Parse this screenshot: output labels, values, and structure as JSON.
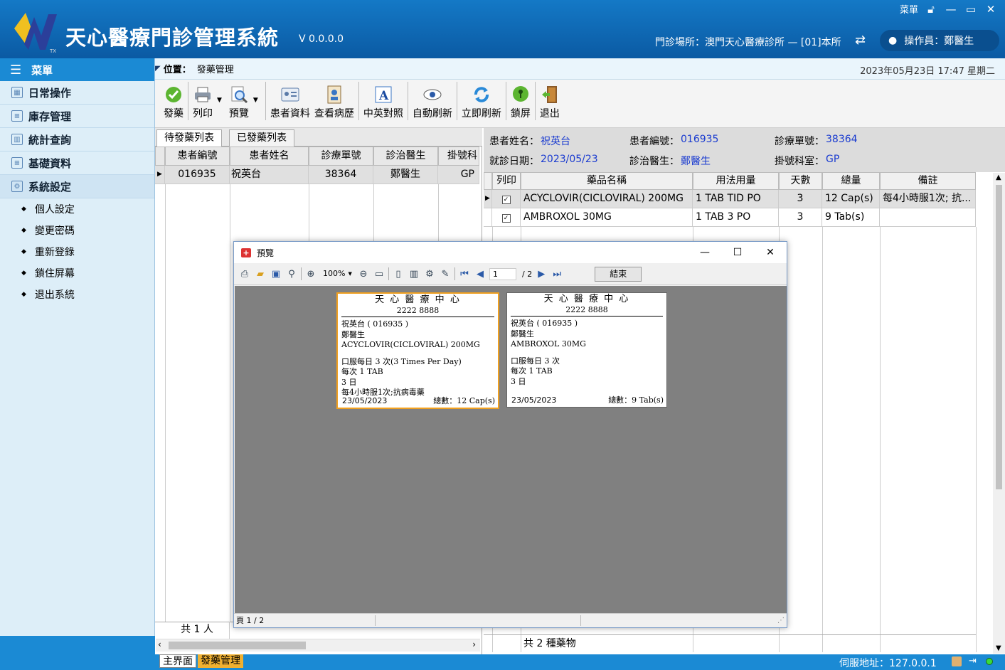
{
  "app": {
    "title": "天心醫療門診管理系統",
    "version": "V 0.0.0.0"
  },
  "header": {
    "menu_label": "菜單",
    "clinic_label": "門診場所：澳門天心醫療診所 — [01]本所",
    "operator_label": "操作員：鄭醫生"
  },
  "sidebar": {
    "title": "菜單",
    "items": [
      {
        "label": "日常操作"
      },
      {
        "label": "庫存管理"
      },
      {
        "label": "統計查詢"
      },
      {
        "label": "基礎資料"
      },
      {
        "label": "系統設定"
      }
    ],
    "sub_items": [
      {
        "label": "個人設定"
      },
      {
        "label": "變更密碼"
      },
      {
        "label": "重新登錄"
      },
      {
        "label": "鎖住屏幕"
      },
      {
        "label": "退出系統"
      }
    ]
  },
  "location": {
    "label": "位置：",
    "value": "發藥管理",
    "datetime": "2023年05月23日 17:47  星期二"
  },
  "toolbar": {
    "dispense": "發藥",
    "print": "列印",
    "preview": "預覽",
    "patient_info": "患者資料",
    "view_history": "查看病歷",
    "cn_en": "中英對照",
    "auto_refresh": "自動刷新",
    "refresh_now": "立即刷新",
    "lock_screen": "鎖屏",
    "exit": "退出"
  },
  "tabs": {
    "pending": "待發藥列表",
    "dispensed": "已發藥列表"
  },
  "left_grid": {
    "headers": [
      "患者編號",
      "患者姓名",
      "診療單號",
      "診治醫生",
      "掛號科"
    ],
    "rows": [
      [
        "016935",
        "祝英台",
        "38364",
        "鄭醫生",
        "GP"
      ]
    ],
    "footer": "共 1 人"
  },
  "patient_info": {
    "name_label": "患者姓名：",
    "name": "祝英台",
    "id_label": "患者編號：",
    "id": "016935",
    "order_label": "診療單號：",
    "order": "38364",
    "date_label": "就診日期：",
    "date": "2023/05/23",
    "doctor_label": "診治醫生：",
    "doctor": "鄭醫生",
    "dept_label": "掛號科室：",
    "dept": "GP"
  },
  "right_grid": {
    "headers": [
      "列印",
      "藥品名稱",
      "用法用量",
      "天數",
      "總量",
      "備註"
    ],
    "rows": [
      {
        "drug": "ACYCLOVIR(CICLOVIRAL) 200MG",
        "usage": "1 TAB TID PO",
        "days": "3",
        "total": "12 Cap(s)",
        "note": "每4小時服1次; 抗..."
      },
      {
        "drug": "AMBROXOL 30MG",
        "usage": "1 TAB 3 PO",
        "days": "3",
        "total": "9 Tab(s)",
        "note": ""
      }
    ],
    "footer": "共 2 種藥物"
  },
  "preview": {
    "title": "預覽",
    "zoom": "100%",
    "page_input": "1",
    "page_total": "/ 2",
    "close_button": "結束",
    "status": "頁 1 / 2",
    "labels": [
      {
        "clinic": "天 心 醫 療 中 心",
        "phone": "2222 8888",
        "patient": "祝英台 ( 016935 )",
        "doctor": "鄭醫生",
        "drug": "ACYCLOVIR(CICLOVIRAL) 200MG",
        "line1": "口服每日 3 次(3 Times Per Day)",
        "line2": "每次 1 TAB",
        "line3": "3 日",
        "note": "每4小時服1次;抗病毒藥",
        "date": "23/05/2023",
        "total": "總數：12 Cap(s)"
      },
      {
        "clinic": "天 心 醫 療 中 心",
        "phone": "2222 8888",
        "patient": "祝英台 ( 016935 )",
        "doctor": "鄭醫生",
        "drug": "AMBROXOL 30MG",
        "line1": "口服每日 3 次",
        "line2": "每次 1 TAB",
        "line3": "3 日",
        "note": "",
        "date": "23/05/2023",
        "total": "總數：9 Tab(s)"
      }
    ]
  },
  "footer": {
    "tab_main": "主界面",
    "tab_dispense": "發藥管理",
    "server": "伺服地址：127.0.0.1"
  },
  "colors": {
    "header_blue": "#0f68b3",
    "accent_blue": "#1b8ad4",
    "link_blue": "#1a3bd0",
    "active_tab": "#f0b030"
  }
}
